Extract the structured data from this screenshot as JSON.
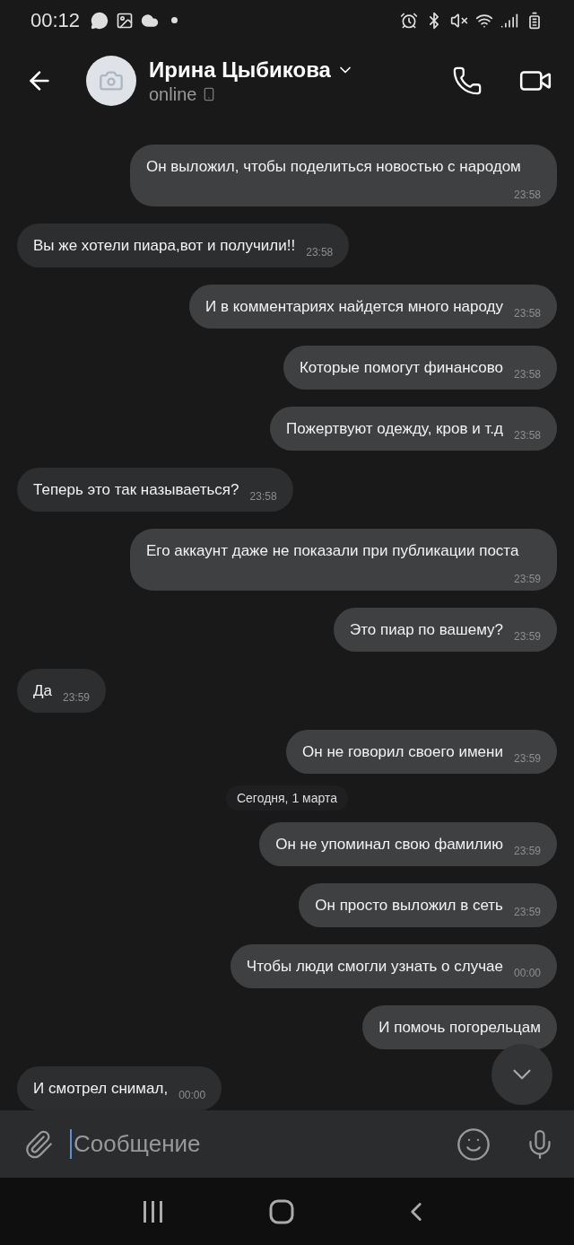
{
  "status_bar": {
    "time": "00:12"
  },
  "header": {
    "name": "Ирина Цыбикова",
    "status": "online"
  },
  "messages": [
    {
      "kind": "message",
      "outgoing": true,
      "text": "Он выложил, чтобы поделиться новостью с народом",
      "time": "23:58"
    },
    {
      "kind": "message",
      "outgoing": false,
      "text": "Вы же хотели пиара,вот и получили!!",
      "time": "23:58"
    },
    {
      "kind": "message",
      "outgoing": true,
      "text": "И в комментариях найдется много народу",
      "time": "23:58"
    },
    {
      "kind": "message",
      "outgoing": true,
      "text": "Которые помогут финансово",
      "time": "23:58"
    },
    {
      "kind": "message",
      "outgoing": true,
      "text": "Пожертвуют одежду, кров и т.д",
      "time": "23:58"
    },
    {
      "kind": "message",
      "outgoing": false,
      "text": "Теперь это так называеться?",
      "time": "23:58"
    },
    {
      "kind": "message",
      "outgoing": true,
      "text": "Его аккаунт даже не показали при публикации поста",
      "time": "23:59"
    },
    {
      "kind": "message",
      "outgoing": true,
      "text": "Это пиар по вашему?",
      "time": "23:59"
    },
    {
      "kind": "message",
      "outgoing": false,
      "text": "Да",
      "time": "23:59"
    },
    {
      "kind": "message",
      "outgoing": true,
      "text": "Он не говорил своего имени",
      "time": "23:59"
    },
    {
      "kind": "date",
      "text": "Сегодня, 1 марта"
    },
    {
      "kind": "message",
      "outgoing": true,
      "text": "Он не упоминал свою фамилию",
      "time": "23:59"
    },
    {
      "kind": "message",
      "outgoing": true,
      "text": "Он просто выложил в сеть",
      "time": "23:59"
    },
    {
      "kind": "message",
      "outgoing": true,
      "text": "Чтобы люди смогли узнать о случае",
      "time": "00:00"
    },
    {
      "kind": "message",
      "outgoing": true,
      "text": "И помочь погорельцам"
    },
    {
      "kind": "message",
      "outgoing": false,
      "text": "И смотрел снимал,",
      "time": "00:00"
    }
  ],
  "composer": {
    "placeholder": "Сообщение"
  }
}
